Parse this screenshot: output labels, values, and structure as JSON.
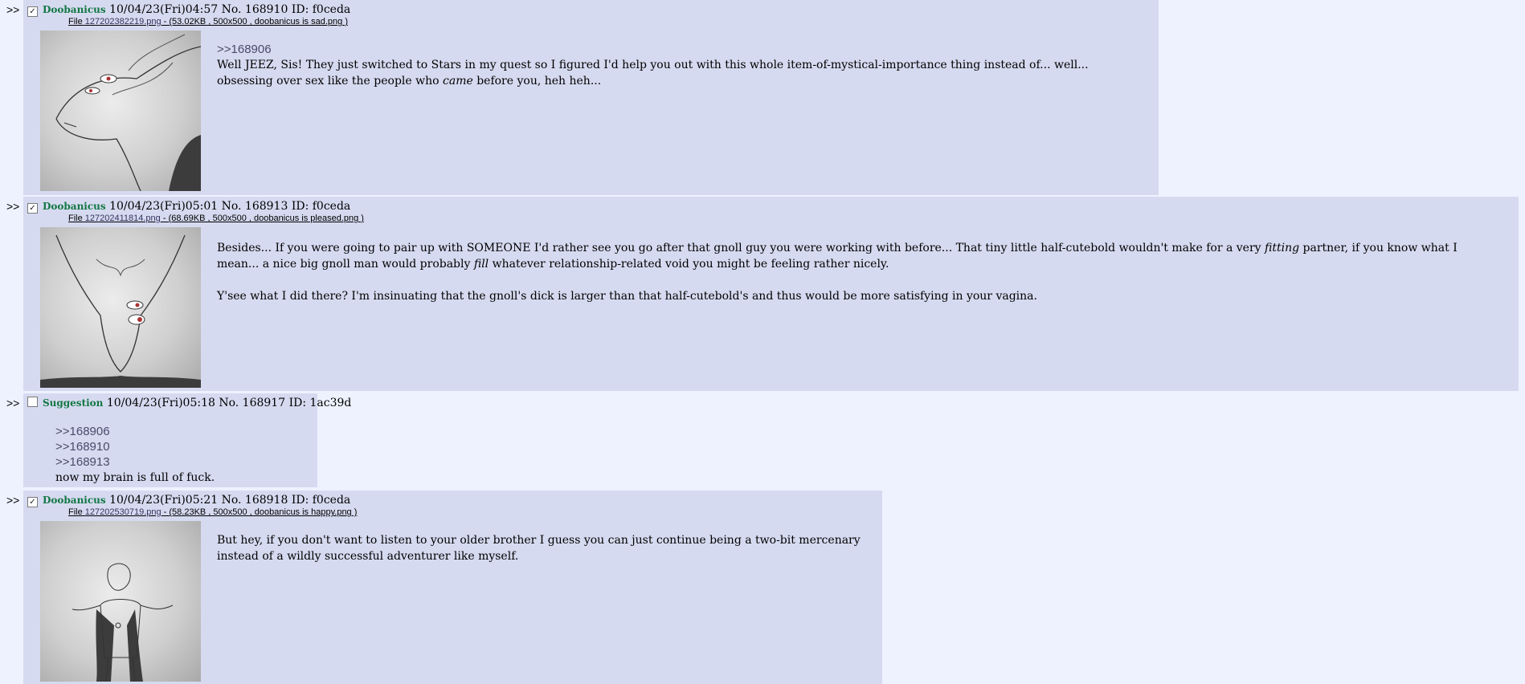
{
  "posts": [
    {
      "arrows": ">>",
      "checked": true,
      "name": "Doobanicus",
      "datetime": "10/04/23(Fri)04:57",
      "no": "No. 168910",
      "id": "ID: f0ceda",
      "file_prefix": "File ",
      "file_link": "127202382219.png",
      "file_meta": " - (53.02KB , 500x500 , doobanicus is sad.png )",
      "quote": ">>168906",
      "text_a": "Well JEEZ, Sis! They just switched to Stars in my quest so I figured I'd help you out with this whole item-of-mystical-importance thing instead of... well... obsessing over sex like the people who ",
      "text_em": "came",
      "text_b": " before you, heh heh..."
    },
    {
      "arrows": ">>",
      "checked": true,
      "name": "Doobanicus",
      "datetime": "10/04/23(Fri)05:01",
      "no": "No. 168913",
      "id": "ID: f0ceda",
      "file_prefix": "File ",
      "file_link": "127202411814.png",
      "file_meta": " - (68.69KB , 500x500 , doobanicus is pleased.png )",
      "p1_a": "Besides... If you were going to pair up with SOMEONE I'd rather see you go after that gnoll guy you were working with before... That tiny little half-cutebold wouldn't make for a very ",
      "p1_em1": "fitting",
      "p1_b": " partner, if you know what I mean... a nice big gnoll man would probably ",
      "p1_em2": "fill",
      "p1_c": " whatever relationship-related void you might be feeling rather nicely.",
      "p2": "Y'see what I did there? I'm insinuating that the gnoll's dick is larger than that half-cutebold's and thus would be more satisfying in your vagina."
    },
    {
      "arrows": ">>",
      "checked": false,
      "name": "Suggestion",
      "datetime": "10/04/23(Fri)05:18",
      "no": "No. 168917",
      "id": "ID: 1ac39d",
      "quotes": [
        ">>168906",
        ">>168910",
        ">>168913"
      ],
      "text": "now my brain is full of fuck."
    },
    {
      "arrows": ">>",
      "checked": true,
      "name": "Doobanicus",
      "datetime": "10/04/23(Fri)05:21",
      "no": "No. 168918",
      "id": "ID: f0ceda",
      "file_prefix": "File ",
      "file_link": "127202530719.png",
      "file_meta": " - (58.23KB , 500x500 , doobanicus is happy.png )",
      "text": "But hey, if you don't want to listen to your older brother I guess you can just continue being a two-bit mercenary instead of a wildly successful adventurer like myself."
    }
  ],
  "colors": {
    "page_bg": "#eef2ff",
    "reply_bg": "#d6daf0",
    "name": "#117743",
    "link": "#34345c"
  }
}
